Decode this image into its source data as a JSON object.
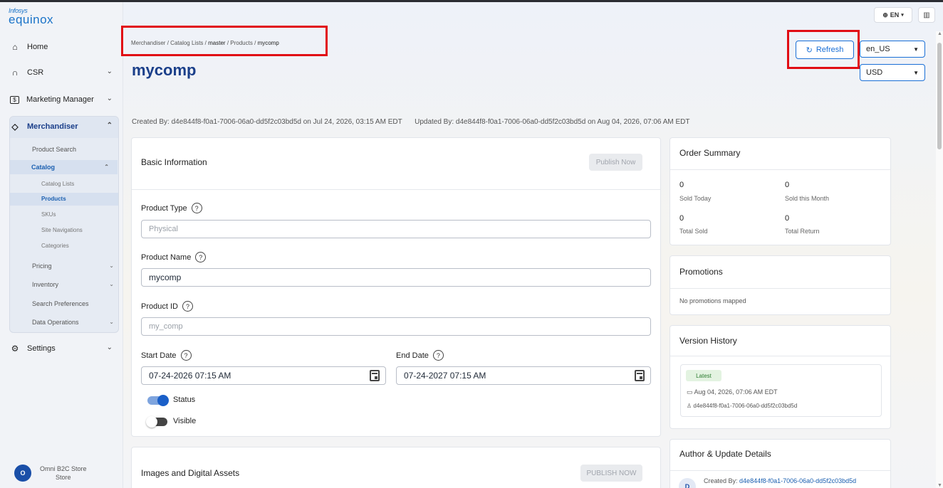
{
  "sidebar": {
    "logo_top": "Infosys",
    "logo_bottom": "equinox",
    "home": "Home",
    "csr": "CSR",
    "marketing_manager": "Marketing Manager",
    "merchandiser": "Merchandiser",
    "product_search": "Product Search",
    "catalog": "Catalog",
    "catalog_lists": "Catalog Lists",
    "products": "Products",
    "skus": "SKUs",
    "site_navigations": "Site Navigations",
    "categories": "Categories",
    "pricing": "Pricing",
    "inventory": "Inventory",
    "search_preferences": "Search Preferences",
    "data_operations": "Data Operations",
    "settings": "Settings",
    "store_avatar": "O",
    "store_name": "Omni B2C Store",
    "store_type": "Store"
  },
  "topbar": {
    "language": "EN"
  },
  "breadcrumb": {
    "merchandiser": "Merchandiser",
    "catalog_lists": "Catalog Lists",
    "master": "master",
    "products": "Products",
    "current": "mycomp",
    "sep": "/"
  },
  "page": {
    "title": "mycomp",
    "refresh": "Refresh",
    "locale": "en_US",
    "currency": "USD",
    "created_by": "Created By: d4e844f8-f0a1-7006-06a0-dd5f2c03bd5d on Jul 24, 2026, 03:15 AM EDT",
    "updated_by": "Updated By: d4e844f8-f0a1-7006-06a0-dd5f2c03bd5d on Aug 04, 2026, 07:06 AM EDT"
  },
  "basic_info": {
    "title": "Basic Information",
    "publish_now": "Publish Now",
    "product_type_label": "Product Type",
    "product_type_placeholder": "Physical",
    "product_name_label": "Product Name",
    "product_name_value": "mycomp",
    "product_id_label": "Product ID",
    "product_id_placeholder": "my_comp",
    "start_date_label": "Start Date",
    "start_date_value": "07-24-2026 07:15 AM",
    "end_date_label": "End Date",
    "end_date_value": "07-24-2027 07:15 AM",
    "status_label": "Status",
    "visible_label": "Visible",
    "help": "?"
  },
  "images": {
    "title": "Images and Digital Assets",
    "publish_now": "PUBLISH NOW"
  },
  "order_summary": {
    "title": "Order Summary",
    "sold_today_value": "0",
    "sold_today_label": "Sold Today",
    "sold_month_value": "0",
    "sold_month_label": "Sold this Month",
    "total_sold_value": "0",
    "total_sold_label": "Total Sold",
    "total_return_value": "0",
    "total_return_label": "Total Return"
  },
  "promotions": {
    "title": "Promotions",
    "empty": "No promotions mapped"
  },
  "version_history": {
    "title": "Version History",
    "badge": "Latest",
    "date": "Aug 04, 2026, 07:06 AM EDT",
    "user": "d4e844f8-f0a1-7006-06a0-dd5f2c03bd5d"
  },
  "author": {
    "title": "Author & Update Details",
    "created_by_label": "Created By:",
    "created_by_value": "d4e844f8-f0a1-7006-06a0-dd5f2c03bd5d",
    "avatar": "D"
  }
}
